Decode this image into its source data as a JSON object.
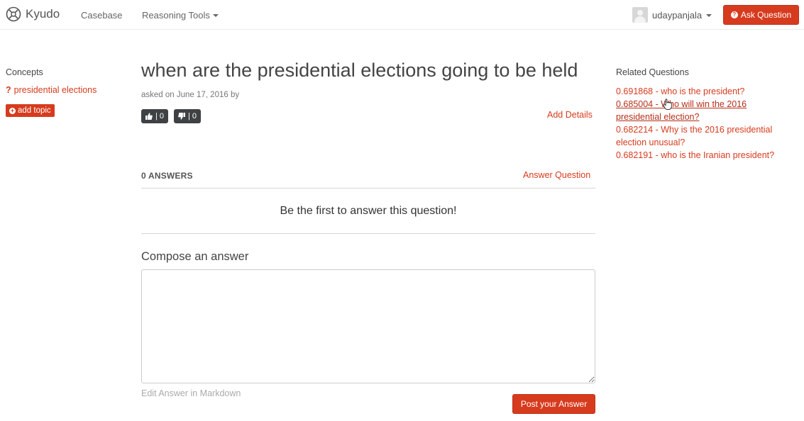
{
  "navbar": {
    "brand": "Kyudo",
    "casebase": "Casebase",
    "reasoning_tools": "Reasoning Tools",
    "username": "udaypanjala",
    "ask_question": "Ask Question"
  },
  "sidebar": {
    "concepts_title": "Concepts",
    "concept": "presidential elections",
    "add_topic": "add topic"
  },
  "question": {
    "title": "when are the presidential elections going to be held",
    "asked": "asked on June 17, 2016 by",
    "upvote_label": "| 0",
    "downvote_label": "| 0",
    "add_details": "Add Details"
  },
  "answers": {
    "count_label": "0 ANSWERS",
    "answer_question": "Answer Question",
    "empty_message": "Be the first to answer this question!"
  },
  "compose": {
    "title": "Compose an answer",
    "textarea_value": "",
    "edit_markdown": "Edit Answer in Markdown",
    "post_button": "Post your Answer"
  },
  "related": {
    "title": "Related Questions",
    "items": [
      {
        "line1": "0.691868 - who is the president?",
        "line2": ""
      },
      {
        "line1": "0.685004 - Who will win the 2016",
        "line2": "presidential election?"
      },
      {
        "line1": "0.682214 - Why is the 2016 presidential",
        "line2": "election unusual?"
      },
      {
        "line1": "0.682191 - who is the Iranian president?",
        "line2": ""
      }
    ]
  },
  "colors": {
    "accent": "#d73b1e",
    "vote_bg": "#3f4244"
  },
  "icons": [
    "kyudo-logo-icon",
    "caret-down-icon",
    "question-circle-icon",
    "question-mark-icon",
    "plus-circle-icon",
    "thumbs-up-icon",
    "thumbs-down-icon",
    "hand-cursor-icon"
  ]
}
